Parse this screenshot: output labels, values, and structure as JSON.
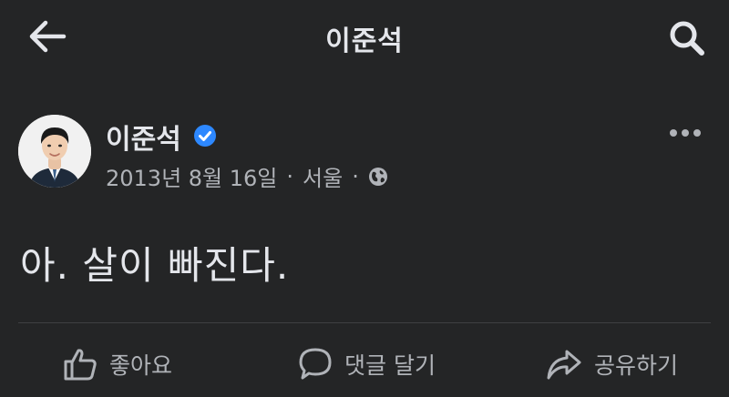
{
  "header": {
    "title": "이준석",
    "back_icon": "arrow-left-icon",
    "search_icon": "search-icon"
  },
  "post": {
    "author": "이준석",
    "verified_icon": "verified-badge-icon",
    "date": "2013년 8월 16일",
    "separator": "·",
    "location": "서울",
    "privacy_icon": "globe-icon",
    "more_icon": "more-dots-icon",
    "text": "아. 살이 빠진다."
  },
  "actions": {
    "like": "좋아요",
    "comment": "댓글 달기",
    "share": "공유하기"
  },
  "colors": {
    "background": "#242526",
    "text_primary": "#e4e6eb",
    "text_secondary": "#b0b3b8",
    "verified": "#2d88ff"
  }
}
